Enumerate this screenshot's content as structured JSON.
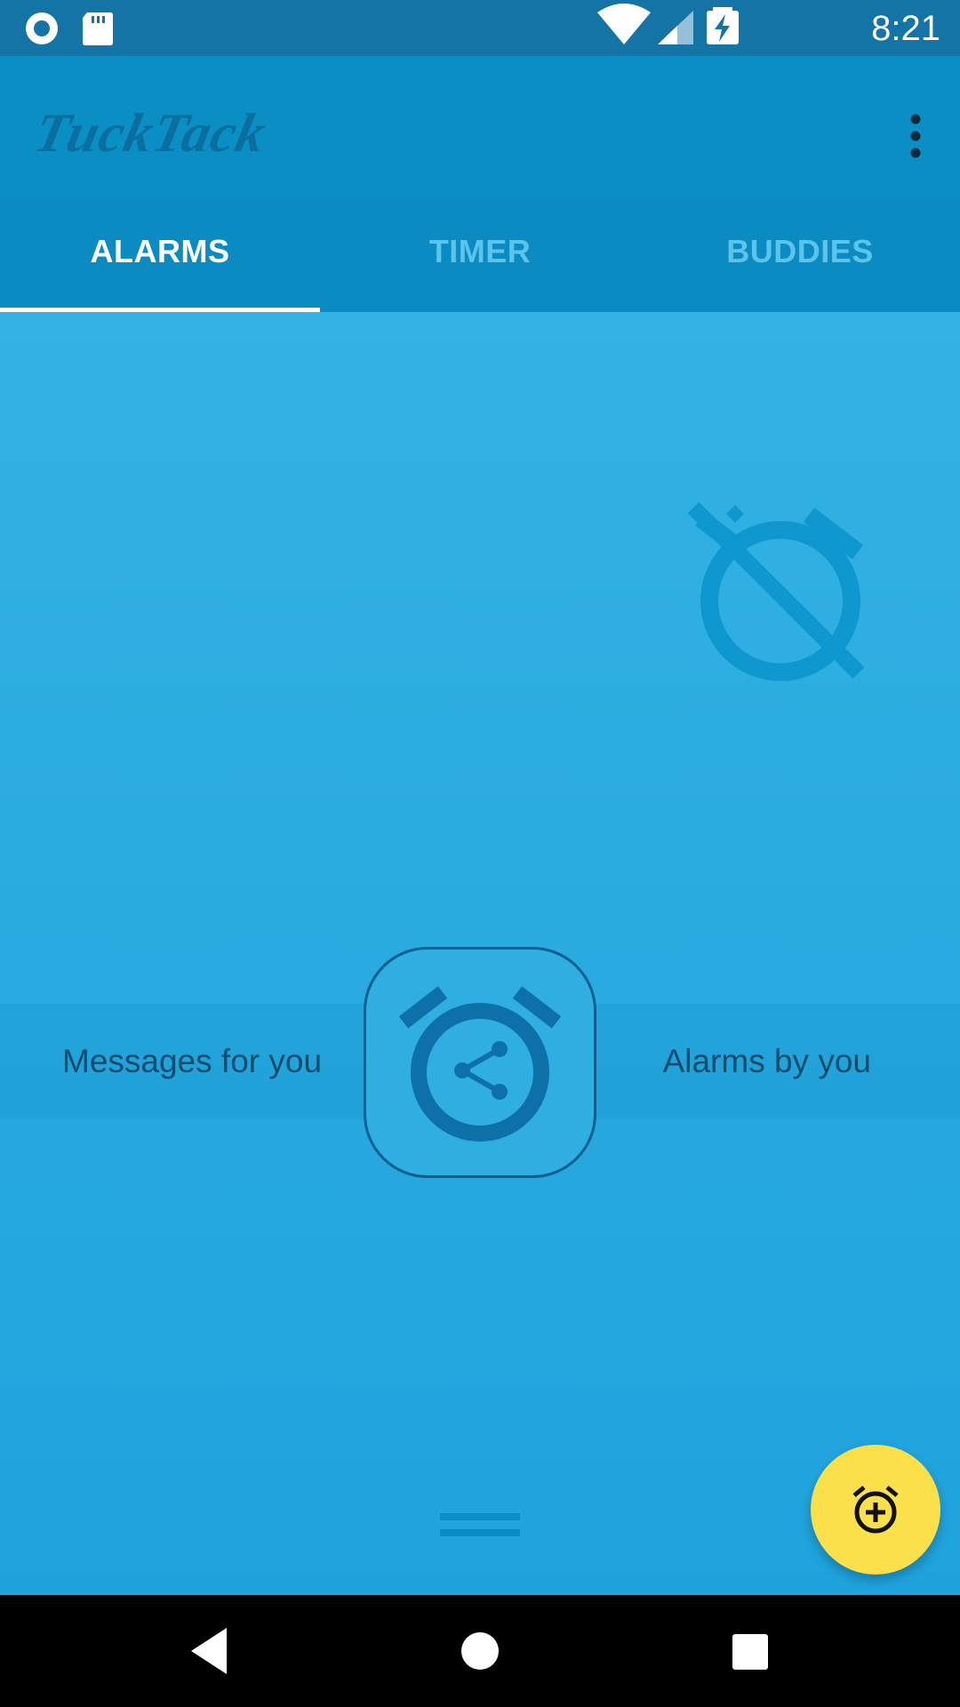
{
  "status_bar": {
    "time": "8:21",
    "left_icons": [
      "record-icon",
      "sd-card-icon"
    ],
    "right_icons": [
      "wifi-icon",
      "signal-icon",
      "battery-charging-icon"
    ]
  },
  "app_bar": {
    "logo_text": "TuckTack",
    "overflow_icon": "more-vert-icon"
  },
  "tabs": [
    {
      "label": "ALARMS",
      "active": true
    },
    {
      "label": "TIMER",
      "active": false
    },
    {
      "label": "BUDDIES",
      "active": false
    }
  ],
  "content": {
    "empty_icon": "alarm-off-icon",
    "center_icon": "alarm-share-icon",
    "left_label": "Messages for you",
    "right_label": "Alarms by you",
    "drag_handle_icon": "drag-handle-icon"
  },
  "fab": {
    "icon": "alarm-add-icon",
    "color": "#fbe04a"
  },
  "nav_bar": {
    "buttons": [
      "back-icon",
      "home-icon",
      "recents-icon"
    ]
  },
  "colors": {
    "status_bar": "#1474a6",
    "app_bar": "#0a8fc5",
    "content_top": "#33b2e3",
    "content_bottom": "#1fa3dd",
    "tab_active": "#ffffff",
    "tab_inactive": "#5cc3ea"
  }
}
